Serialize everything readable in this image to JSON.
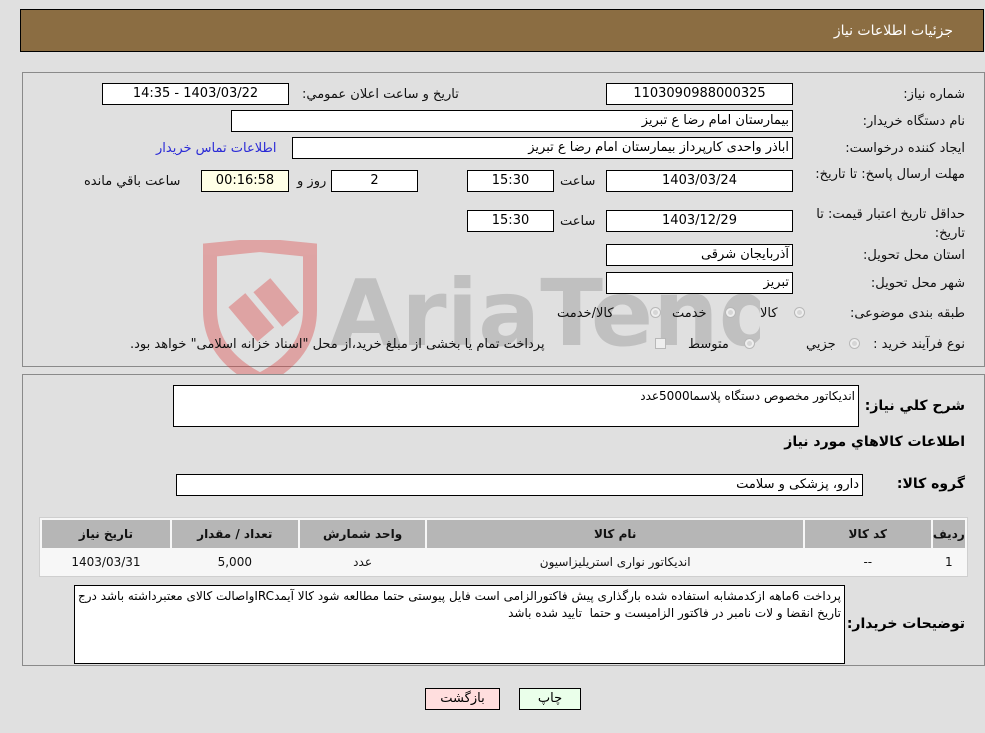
{
  "header": {
    "title": "جزئیات اطلاعات نیاز"
  },
  "form": {
    "need_number": {
      "label": "شماره نیاز:",
      "value": "1103090988000325"
    },
    "announce_datetime": {
      "label": "تاریخ و ساعت اعلان عمومي:",
      "value": "1403/03/22 - 14:35"
    },
    "buyer_org": {
      "label": "نام دستگاه خریدار:",
      "value": "بیمارستان امام رضا  ع  تبریز"
    },
    "requester": {
      "label": "ایجاد کننده درخواست:",
      "value": "اباذر واحدی کارپرداز بیمارستان امام رضا  ع  تبریز"
    },
    "buyer_contact_link": "اطلاعات تماس خریدار",
    "reply_deadline": {
      "label": "مهلت ارسال پاسخ: تا تاریخ:",
      "date": "1403/03/24",
      "time_label": "ساعت",
      "time": "15:30",
      "days": "2",
      "days_label": "روز و",
      "remaining": "00:16:58",
      "remaining_label": "ساعت باقي مانده"
    },
    "price_validity": {
      "label": "حداقل تاریخ اعتبار قیمت: تا تاریخ:",
      "date": "1403/12/29",
      "time_label": "ساعت",
      "time": "15:30"
    },
    "delivery_province": {
      "label": "استان محل تحویل:",
      "value": "آذربایجان شرقی"
    },
    "delivery_city": {
      "label": "شهر محل تحویل:",
      "value": "تبریز"
    },
    "category": {
      "label": "طبقه بندی موضوعی:",
      "options": [
        "کالا",
        "خدمت",
        "کالا/خدمت"
      ]
    },
    "purchase_type": {
      "label": "نوع فرآیند خرید :",
      "options": [
        "جزيي",
        "متوسط"
      ],
      "note": "پرداخت تمام یا بخشی از مبلغ خرید،از محل \"اسناد خزانه اسلامی\" خواهد بود."
    }
  },
  "details": {
    "summary_label": "شرح كلي نیاز:",
    "summary_value": "اندیکاتور مخصوص دستگاه پلاسما5000عدد",
    "goods_info_title": "اطلاعات كالاهاي مورد نیاز",
    "goods_group_label": "گروه کالا:",
    "goods_group_value": "دارو، پزشکی و سلامت",
    "table": {
      "headers": [
        "ردیف",
        "کد کالا",
        "نام کالا",
        "واحد شمارش",
        "تعداد / مقدار",
        "تاریخ نیاز"
      ],
      "rows": [
        [
          "1",
          "--",
          "اندیکاتور نواری استریلیزاسیون",
          "عدد",
          "5,000",
          "1403/03/31"
        ]
      ]
    },
    "buyer_notes_label": "توضیحات خریدار:",
    "buyer_notes_value": "پرداخت 6ماهه ازکدمشابه استفاده شده بارگذاری پیش فاکتورالزامی است فایل پیوستی حتما مطالعه شود کالا آیمدIRCواصالت کالای معتبرداشته باشد درج تاریخ انقضا و لات نامبر در فاکتور الزامیست و حتما  تایید شده باشد"
  },
  "buttons": {
    "print": "چاپ",
    "back": "بازگشت"
  },
  "watermark": {
    "text": "AriaTender.neT"
  },
  "colors": {
    "header_bg": "#8b6d42",
    "link": "#2a2ad6",
    "back_bg": "#ffdede",
    "print_bg": "#eaffea",
    "remaining_bg": "#ffffe6"
  }
}
